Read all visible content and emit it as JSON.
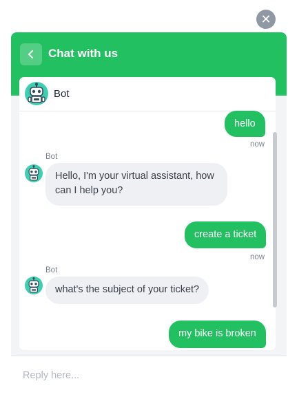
{
  "close_button": {
    "icon": "close-icon",
    "glyph": "✕"
  },
  "header": {
    "title": "Chat with us",
    "back_icon": "chevron-left-icon",
    "color": "#23c062"
  },
  "agent": {
    "name": "Bot",
    "avatar_icon": "robot-avatar-icon"
  },
  "messages": [
    {
      "from": "user",
      "text": "hello",
      "time": "now"
    },
    {
      "from": "bot",
      "sender": "Bot",
      "text": "Hello, I'm your virtual assistant, how can I help you?"
    },
    {
      "from": "user",
      "text": "create a ticket",
      "time": "now"
    },
    {
      "from": "bot",
      "sender": "Bot",
      "text": "what's the subject of your ticket?"
    },
    {
      "from": "user",
      "text": "my bike is broken"
    }
  ],
  "composer": {
    "placeholder": "Reply here..."
  },
  "colors": {
    "accent": "#23c062",
    "bot_bubble": "#eef0f3",
    "avatar": "#3ecfb0"
  }
}
